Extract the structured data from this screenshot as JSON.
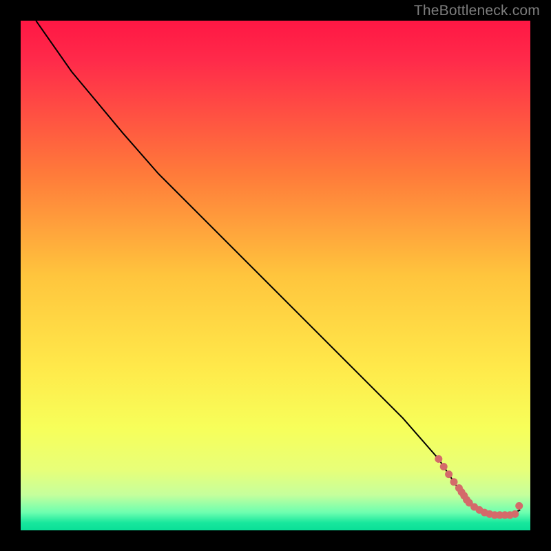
{
  "attribution": "TheBottleneck.com",
  "chart_data": {
    "type": "line",
    "title": "",
    "xlabel": "",
    "ylabel": "",
    "xlim": [
      0,
      100
    ],
    "ylim": [
      0,
      100
    ],
    "grid": false,
    "legend": false,
    "series": [
      {
        "name": "curve",
        "color": "#000000",
        "x": [
          3,
          10,
          20,
          27,
          35,
          45,
          55,
          65,
          75,
          82,
          86,
          88,
          90,
          92,
          94,
          96,
          98
        ],
        "y": [
          100,
          90,
          78,
          70,
          62,
          52,
          42,
          32,
          22,
          14,
          8,
          5,
          4,
          3,
          3,
          3,
          4
        ]
      }
    ],
    "markers": {
      "name": "points",
      "color": "#d46a6a",
      "x": [
        82,
        83,
        84,
        85,
        86,
        86.5,
        87,
        87.5,
        88,
        89,
        90,
        91,
        92,
        93,
        94,
        95,
        96,
        97,
        97.8
      ],
      "y": [
        14,
        12.5,
        11,
        9.5,
        8.3,
        7.5,
        6.8,
        6,
        5.4,
        4.6,
        4,
        3.5,
        3.2,
        3,
        3,
        3,
        3,
        3.2,
        4.8
      ]
    },
    "background": {
      "type": "vertical_gradient",
      "stops": [
        {
          "offset": 0.0,
          "color": "#ff1744"
        },
        {
          "offset": 0.08,
          "color": "#ff2b4a"
        },
        {
          "offset": 0.3,
          "color": "#ff7a3a"
        },
        {
          "offset": 0.5,
          "color": "#ffc53d"
        },
        {
          "offset": 0.68,
          "color": "#ffe94a"
        },
        {
          "offset": 0.8,
          "color": "#f7ff5a"
        },
        {
          "offset": 0.88,
          "color": "#e8ff78"
        },
        {
          "offset": 0.93,
          "color": "#c6ff9c"
        },
        {
          "offset": 0.965,
          "color": "#6dffb0"
        },
        {
          "offset": 0.985,
          "color": "#18e79d"
        },
        {
          "offset": 1.0,
          "color": "#0adf97"
        }
      ]
    }
  }
}
